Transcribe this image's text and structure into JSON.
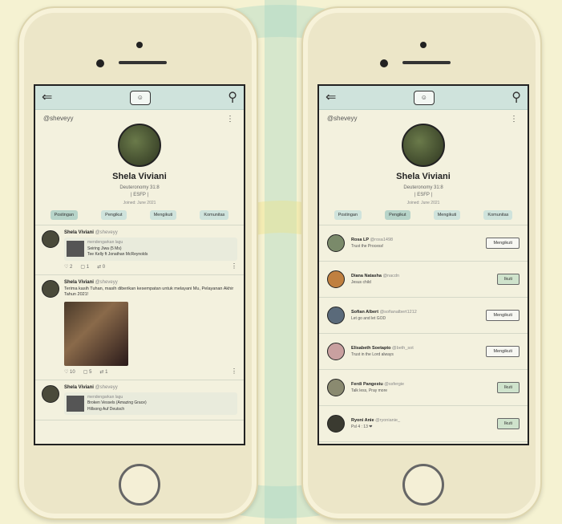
{
  "left": {
    "handle": "@sheveyy",
    "profile": {
      "name": "Shela Viviani",
      "bio_line1": "Deuteronomy 31:8",
      "bio_line2": "| ESFP |",
      "joined": "Joined: June 2021"
    },
    "tabs": [
      "Postingan",
      "Pengikut",
      "Mengikuti",
      "Komunitas"
    ],
    "posts": [
      {
        "name": "Shela Viviani",
        "handle": "@sheveyy",
        "kind": "music",
        "status": "mendengarkan lagu",
        "song": "Seiring Jiwa (5 Ms)",
        "artist": "Tee Kelly ft Jonathan McReynolds",
        "likes": "2",
        "comments": "1",
        "shares": "0"
      },
      {
        "name": "Shela Viviani",
        "handle": "@sheveyy",
        "kind": "photo",
        "text": "Terima kasih Tuhan, masih diberikan kesempatan untuk melayani Mu, Pelayanan Akhir Tahun 2021!",
        "likes": "10",
        "comments": "5",
        "shares": "1"
      },
      {
        "name": "Shela Viviani",
        "handle": "@sheveyy",
        "kind": "music",
        "status": "mendengarkan lagu",
        "song": "Broken Vessels (Amazing Grace)",
        "artist": "Hillsong Auf Deutsch"
      }
    ]
  },
  "right": {
    "handle": "@sheveyy",
    "profile": {
      "name": "Shela Viviani",
      "bio_line1": "Deuteronomy 31:8",
      "bio_line2": "| ESFP |",
      "joined": "Joined: June 2021"
    },
    "tabs": [
      "Postingan",
      "Pengikut",
      "Mengikuti",
      "Komunitas"
    ],
    "followers": [
      {
        "name": "Rosa LP",
        "handle": "@rosa1498",
        "bio": "Trust the Process!",
        "button": "Mengikuti"
      },
      {
        "name": "Diana Natasha",
        "handle": "@nacdn",
        "bio": "Jesus child",
        "button": "Ikuti"
      },
      {
        "name": "Sofian Albert",
        "handle": "@sofianalbert1212",
        "bio": "Let go and let GOD",
        "button": "Mengikuti"
      },
      {
        "name": "Elisabeth Soetapto",
        "handle": "@beth_sot",
        "bio": "Trust in the Lord always",
        "button": "Mengikuti"
      },
      {
        "name": "Ferdi Pangestu",
        "handle": "@ssfergie",
        "bio": "Talk less, Pray more",
        "button": "Ikuti"
      },
      {
        "name": "Ryoni Anie",
        "handle": "@ryonianie_",
        "bio": "Psl 4 : 13 ❤",
        "button": "Ikuti"
      }
    ]
  },
  "colors": {
    "header": "#cfe3dc",
    "background": "#f5f2d2",
    "follow_active": "#cfe3cc"
  }
}
